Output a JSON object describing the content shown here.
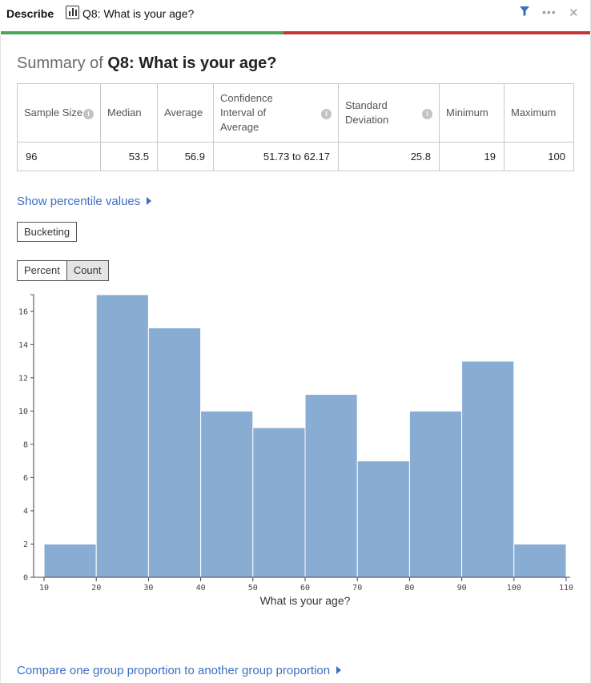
{
  "header": {
    "describe": "Describe",
    "question_title": "Q8: What is your age?",
    "more": "•••",
    "close": "✕"
  },
  "summary": {
    "prefix": "Summary of",
    "question": "Q8: What is your age?"
  },
  "stats_table": {
    "headers": [
      "Sample Size",
      "Median",
      "Average",
      "Confidence Interval of Average",
      "Standard Deviation",
      "Minimum",
      "Maximum"
    ],
    "values": [
      "96",
      "53.5",
      "56.9",
      "51.73 to 62.17",
      "25.8",
      "19",
      "100"
    ],
    "info_icon": "i"
  },
  "links": {
    "percentile": "Show percentile values",
    "compare": "Compare one group proportion to another group proportion"
  },
  "buttons": {
    "bucketing": "Bucketing",
    "percent": "Percent",
    "count": "Count"
  },
  "colors": {
    "bar": "#89acd3",
    "link": "#3b6fc6",
    "progress_green": "#4ea45a",
    "progress_red": "#c6353a"
  },
  "chart_data": {
    "type": "bar",
    "xlabel": "What is your age?",
    "bins": [
      [
        10,
        20
      ],
      [
        20,
        30
      ],
      [
        30,
        40
      ],
      [
        40,
        50
      ],
      [
        50,
        60
      ],
      [
        60,
        70
      ],
      [
        70,
        80
      ],
      [
        80,
        90
      ],
      [
        90,
        100
      ],
      [
        100,
        110
      ]
    ],
    "values": [
      2,
      17,
      15,
      10,
      9,
      11,
      7,
      10,
      13,
      2
    ],
    "xticks": [
      10,
      20,
      30,
      40,
      50,
      60,
      70,
      80,
      90,
      100,
      110
    ],
    "yticks": [
      0,
      2,
      4,
      6,
      8,
      10,
      12,
      14,
      16
    ],
    "xlim": [
      10,
      110
    ],
    "ylim": [
      0,
      17
    ]
  }
}
